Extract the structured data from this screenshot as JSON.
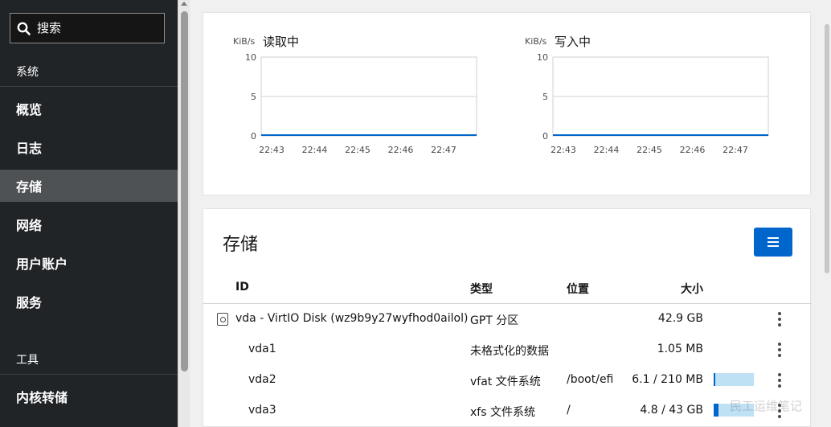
{
  "search": {
    "placeholder": "搜索"
  },
  "sidebar": {
    "section_system": "系统",
    "items": [
      {
        "label": "概览"
      },
      {
        "label": "日志"
      },
      {
        "label": "存储"
      },
      {
        "label": "网络"
      },
      {
        "label": "用户账户"
      },
      {
        "label": "服务"
      }
    ],
    "section_tools": "工具",
    "tool_items": [
      {
        "label": "内核转储"
      }
    ],
    "active": "存储"
  },
  "chart_data": [
    {
      "type": "line",
      "title": "读取中",
      "ylabel": "KiB/s",
      "xlabel": "",
      "x": [
        "22:43",
        "22:44",
        "22:45",
        "22:46",
        "22:47"
      ],
      "yticks": [
        "10",
        "5",
        "0"
      ],
      "ylim": [
        0,
        10
      ],
      "series": [
        {
          "values": [
            0,
            0,
            0,
            0,
            0,
            0
          ]
        }
      ],
      "color": "#0066cc"
    },
    {
      "type": "line",
      "title": "写入中",
      "ylabel": "KiB/s",
      "xlabel": "",
      "x": [
        "22:43",
        "22:44",
        "22:45",
        "22:46",
        "22:47"
      ],
      "yticks": [
        "10",
        "5",
        "0"
      ],
      "ylim": [
        0,
        10
      ],
      "series": [
        {
          "values": [
            0,
            0,
            0,
            0,
            0,
            0
          ]
        }
      ],
      "color": "#0066cc"
    }
  ],
  "storage": {
    "heading": "存储",
    "columns": {
      "id": "ID",
      "type": "类型",
      "location": "位置",
      "size": "大小"
    },
    "rows": [
      {
        "id": "vda - VirtIO Disk (wz9b9y27wyfhod0ailol)",
        "type": "GPT 分区",
        "location": "",
        "size": "42.9 GB"
      },
      {
        "id": "vda1",
        "type": "未格式化的数据",
        "location": "",
        "size": "1.05 MB"
      },
      {
        "id": "vda2",
        "type": "vfat 文件系统",
        "location": "/boot/efi",
        "size": "6.1 / 210 MB",
        "usage": 0.03
      },
      {
        "id": "vda3",
        "type": "xfs 文件系统",
        "location": "/",
        "size": "4.8 / 43 GB",
        "usage": 0.11
      }
    ]
  },
  "watermark": "民工运维笔记",
  "colors": {
    "accent": "#0066cc",
    "sidebar_bg": "#212427",
    "active_bg": "#4f5255",
    "usage_track": "#bee1f4"
  }
}
